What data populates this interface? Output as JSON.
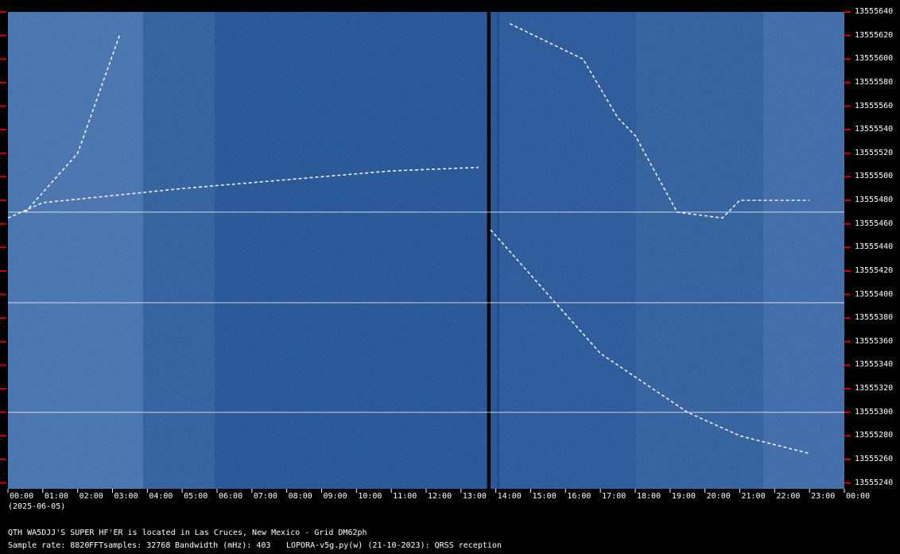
{
  "chart_data": {
    "type": "heatmap",
    "title": "",
    "xlabel": "",
    "ylabel": "",
    "date_label": "(2025-06-05)",
    "x_tick_labels": [
      "00:00",
      "01:00",
      "02:00",
      "03:00",
      "04:00",
      "05:00",
      "06:00",
      "07:00",
      "08:00",
      "09:00",
      "10:00",
      "11:00",
      "12:00",
      "13:00",
      "14:00",
      "15:00",
      "16:00",
      "17:00",
      "18:00",
      "19:00",
      "20:00",
      "21:00",
      "22:00",
      "23:00",
      "00:00"
    ],
    "x_range_hours": [
      0,
      24
    ],
    "data_gap_hours": [
      13.75,
      13.85
    ],
    "y_tick_labels": [
      "13555640",
      "13555620",
      "13555600",
      "13555580",
      "13555560",
      "13555540",
      "13555520",
      "13555500",
      "13555480",
      "13555460",
      "13555440",
      "13555420",
      "13555400",
      "13555380",
      "13555360",
      "13555340",
      "13555320",
      "13555300",
      "13555280",
      "13555260",
      "13555240"
    ],
    "y_range": [
      13555235,
      13555640
    ],
    "y_unit": "Hz",
    "colors": {
      "background": "#000000",
      "waterfall_base": "#1a4a8c",
      "signal": "#ffffff",
      "tick_marks": "#cc0000",
      "labels": "#ffffff"
    },
    "signal_traces": [
      {
        "name": "",
        "points": [
          [
            0.0,
            13555465
          ],
          [
            1.0,
            13555478
          ],
          [
            3.0,
            13555484
          ],
          [
            5.0,
            13555490
          ],
          [
            7.0,
            13555495
          ],
          [
            9.0,
            13555500
          ],
          [
            11.0,
            13555505
          ],
          [
            13.5,
            13555508
          ]
        ]
      },
      {
        "name": "",
        "points": [
          [
            14.4,
            13555630
          ],
          [
            16.5,
            13555600
          ],
          [
            17.5,
            13555550
          ],
          [
            18.0,
            13555535
          ],
          [
            19.2,
            13555470
          ],
          [
            20.5,
            13555465
          ],
          [
            21.0,
            13555480
          ],
          [
            23.0,
            13555480
          ]
        ]
      },
      {
        "name": "",
        "points": [
          [
            13.85,
            13555455
          ],
          [
            15.5,
            13555400
          ],
          [
            17.0,
            13555350
          ],
          [
            18.0,
            13555330
          ],
          [
            19.5,
            13555300
          ],
          [
            21.0,
            13555280
          ],
          [
            23.0,
            13555265
          ]
        ]
      },
      {
        "name": "",
        "points": [
          [
            0.5,
            13555470
          ],
          [
            2.0,
            13555520
          ],
          [
            3.2,
            13555620
          ]
        ]
      }
    ],
    "horizontal_lines": [
      {
        "y": 13555300
      },
      {
        "y": 13555393
      },
      {
        "y": 13555470
      }
    ]
  },
  "footer": {
    "line1": "QTH WA5DJJ'S SUPER HF'ER is located in Las Cruces, New Mexico - Grid DM62ph",
    "sample_rate_label": "Sample rate: 8820",
    "fft_label": "FFTsamples: 32768",
    "bandwidth_label": "Bandwidth (mHz): 403",
    "software_label": "LOPORA-v5g.py(w) (21-10-2023): QRSS reception"
  }
}
